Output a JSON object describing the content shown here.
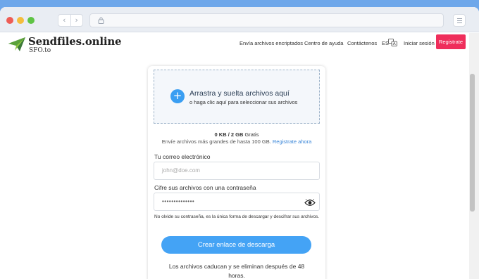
{
  "browser": {
    "back_icon": "chevron-left-icon",
    "forward_icon": "chevron-right-icon",
    "address_icon": "lock-icon",
    "url": "",
    "menu_icon": "hamburger-icon",
    "colors": {
      "close": "#ee5d55",
      "minimize": "#f4bd3c",
      "maximize": "#5fc445"
    }
  },
  "header": {
    "logo_icon": "paper-plane-icon",
    "brand": "Sendfiles.online",
    "subbrand": "SFO.to",
    "nav": {
      "encrypted": "Envía archivos encriptados",
      "help": "Centro de ayuda",
      "contact": "Contáctenos",
      "language": "ES",
      "language_icon": "translate-icon",
      "login": "Iniciar sesión",
      "signup": "Registrate"
    },
    "signup_color": "#ef2e5b"
  },
  "upload": {
    "plus_icon": "+",
    "title": "Arrastra y suelta archivos aquí",
    "subtitle": "o haga clic aquí para seleccionar sus archivos",
    "quota_used": "0 KB / 2 GB",
    "quota_suffix": " Gratis",
    "promo_text": "Envíe archivos más grandes de hasta 100 GB. ",
    "promo_link": "Registrate ahora"
  },
  "form": {
    "email_label": "Tu correo electrónico",
    "email_placeholder": "john@doe.com",
    "password_label": "Cifre sus archivos con una contraseña",
    "password_value": "••••••••••••••",
    "eye_icon": "eye-icon",
    "hint": "No olvide su contraseña, es la única forma de descargar y descifrar sus archivos.",
    "submit": "Crear enlace de descarga",
    "expire_note": "Los archivos caducan y se eliminan después de 48 horas."
  },
  "accent_color": "#44a3f5"
}
